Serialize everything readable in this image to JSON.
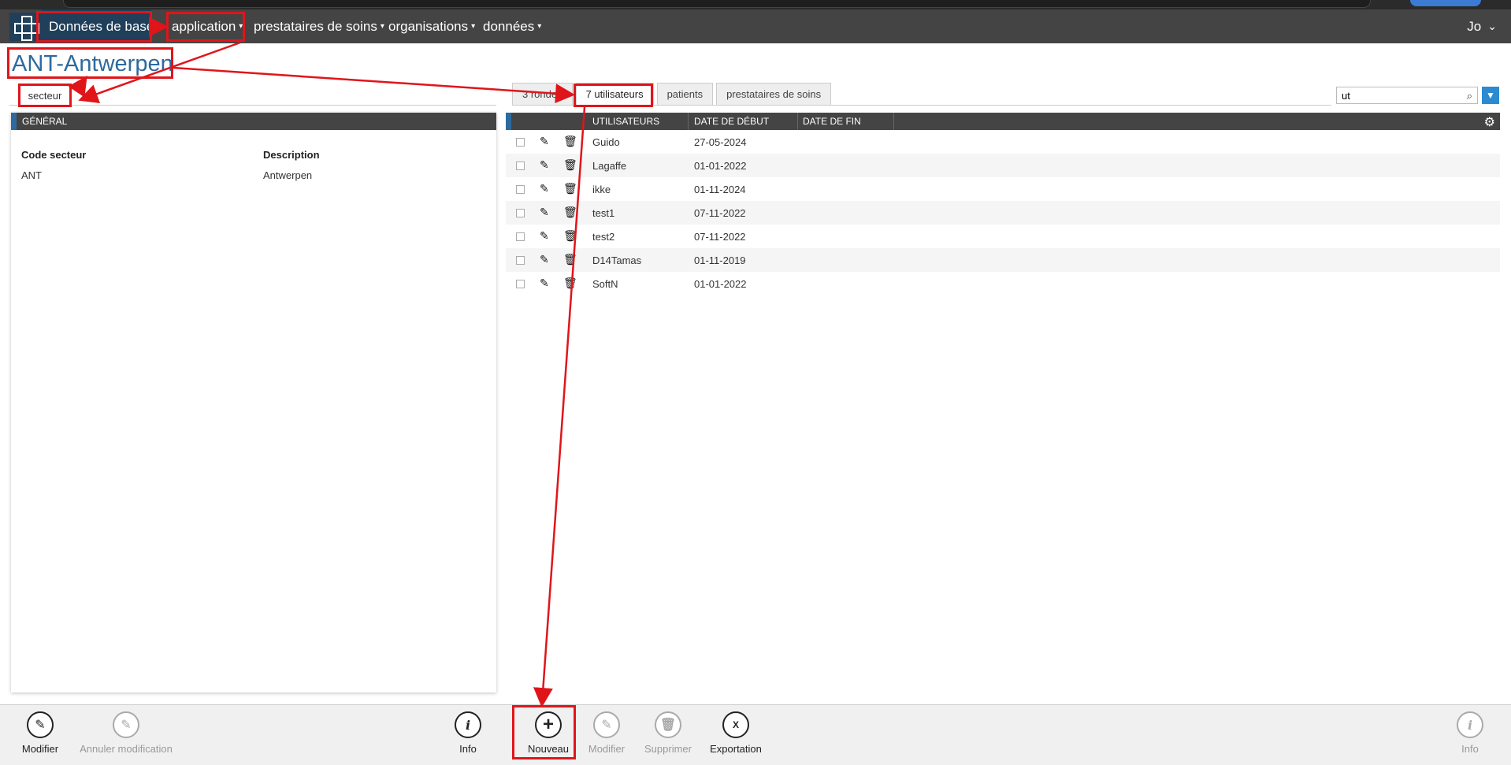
{
  "nav": {
    "items": [
      {
        "label": "Données de base",
        "caret": "▾"
      },
      {
        "label": "application",
        "caret": "▾"
      },
      {
        "label": "prestataires de soins",
        "caret": "▾"
      },
      {
        "label": "organisations",
        "caret": "▾"
      },
      {
        "label": "données",
        "caret": "▾"
      }
    ],
    "user": "Jo",
    "user_caret": "⌄"
  },
  "page": {
    "title": "ANT-Antwerpen",
    "left_tab": "secteur",
    "panel_title": "GÉNÉRAL",
    "fields": [
      {
        "label": "Code secteur",
        "value": "ANT"
      },
      {
        "label": "Description",
        "value": "Antwerpen"
      }
    ]
  },
  "tabs": [
    "3 rondes",
    "7 utilisateurs",
    "patients",
    "prestataires de soins"
  ],
  "search": {
    "value": "ut"
  },
  "grid": {
    "columns": [
      "UTILISATEURS",
      "DATE DE DÉBUT",
      "DATE DE FIN"
    ],
    "rows": [
      {
        "user": "Guido",
        "start": "27-05-2024",
        "end": ""
      },
      {
        "user": "Lagaffe",
        "start": "01-01-2022",
        "end": ""
      },
      {
        "user": "ikke",
        "start": "01-11-2024",
        "end": ""
      },
      {
        "user": "test1",
        "start": "07-11-2022",
        "end": ""
      },
      {
        "user": "test2",
        "start": "07-11-2022",
        "end": ""
      },
      {
        "user": "D14Tamas",
        "start": "01-11-2019",
        "end": ""
      },
      {
        "user": "SoftN",
        "start": "01-01-2022",
        "end": ""
      }
    ]
  },
  "toolbar": {
    "modifier": "Modifier",
    "annuler": "Annuler modification",
    "info": "Info",
    "nouveau": "Nouveau",
    "modifier2": "Modifier",
    "supprimer": "Supprimer",
    "exportation": "Exportation",
    "info2": "Info"
  },
  "icons": {
    "edit": "✎",
    "delete": "🗑",
    "search": "⌕",
    "filter": "▼",
    "gear": "⚙",
    "plus": "+",
    "info": "i",
    "excel": "X"
  },
  "colors": {
    "accent": "#2d6a9f",
    "annotation": "#e0151a",
    "nav": "#444444"
  }
}
